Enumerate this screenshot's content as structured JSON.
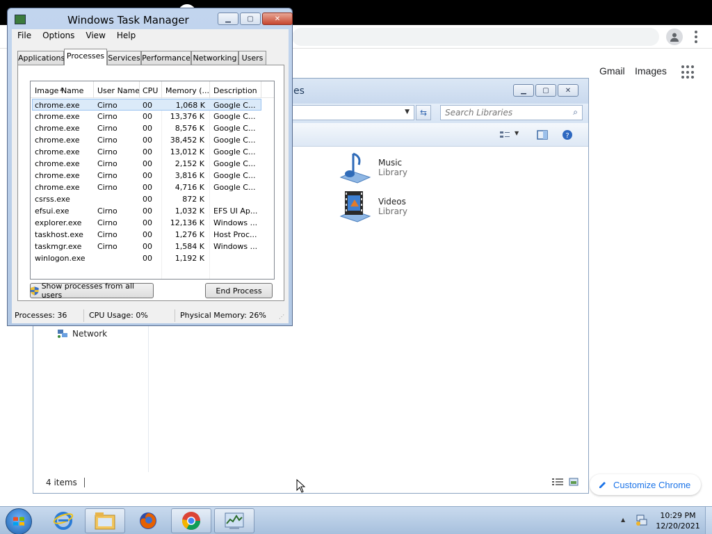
{
  "chrome": {
    "links": {
      "gmail": "Gmail",
      "images": "Images"
    },
    "customize_label": "Customize Chrome",
    "icons": {
      "profile": "profile-icon",
      "menu": "kebab-menu-icon",
      "apps": "apps-grid-icon",
      "pencil": "pencil-icon"
    },
    "accent": "#1a73e8"
  },
  "explorer": {
    "title_fragment": "es",
    "search": {
      "placeholder": "Search Libraries"
    },
    "libraries": [
      {
        "name": "Music",
        "type": "Library",
        "icon": "music-library-icon"
      },
      {
        "name": "Videos",
        "type": "Library",
        "icon": "videos-library-icon"
      }
    ],
    "nav": {
      "network": "Network"
    },
    "status": {
      "items": "4 items"
    }
  },
  "taskmanager": {
    "title": "Windows Task Manager",
    "menu": [
      "File",
      "Options",
      "View",
      "Help"
    ],
    "tabs": [
      "Applications",
      "Processes",
      "Services",
      "Performance",
      "Networking",
      "Users"
    ],
    "active_tab": "Processes",
    "columns": [
      "Image Name",
      "User Name",
      "CPU",
      "Memory (...",
      "Description"
    ],
    "rows": [
      {
        "name": "chrome.exe",
        "user": "Cirno",
        "cpu": "00",
        "mem": "1,068 K",
        "desc": "Google C..."
      },
      {
        "name": "chrome.exe",
        "user": "Cirno",
        "cpu": "00",
        "mem": "13,376 K",
        "desc": "Google C..."
      },
      {
        "name": "chrome.exe",
        "user": "Cirno",
        "cpu": "00",
        "mem": "8,576 K",
        "desc": "Google C..."
      },
      {
        "name": "chrome.exe",
        "user": "Cirno",
        "cpu": "00",
        "mem": "38,452 K",
        "desc": "Google C..."
      },
      {
        "name": "chrome.exe",
        "user": "Cirno",
        "cpu": "00",
        "mem": "13,012 K",
        "desc": "Google C..."
      },
      {
        "name": "chrome.exe",
        "user": "Cirno",
        "cpu": "00",
        "mem": "2,152 K",
        "desc": "Google C..."
      },
      {
        "name": "chrome.exe",
        "user": "Cirno",
        "cpu": "00",
        "mem": "3,816 K",
        "desc": "Google C..."
      },
      {
        "name": "chrome.exe",
        "user": "Cirno",
        "cpu": "00",
        "mem": "4,716 K",
        "desc": "Google C..."
      },
      {
        "name": "csrss.exe",
        "user": "",
        "cpu": "00",
        "mem": "872 K",
        "desc": ""
      },
      {
        "name": "efsui.exe",
        "user": "Cirno",
        "cpu": "00",
        "mem": "1,032 K",
        "desc": "EFS UI Ap..."
      },
      {
        "name": "explorer.exe",
        "user": "Cirno",
        "cpu": "00",
        "mem": "12,136 K",
        "desc": "Windows ..."
      },
      {
        "name": "taskhost.exe",
        "user": "Cirno",
        "cpu": "00",
        "mem": "1,276 K",
        "desc": "Host Proc..."
      },
      {
        "name": "taskmgr.exe",
        "user": "Cirno",
        "cpu": "00",
        "mem": "1,584 K",
        "desc": "Windows ..."
      },
      {
        "name": "winlogon.exe",
        "user": "",
        "cpu": "00",
        "mem": "1,192 K",
        "desc": ""
      }
    ],
    "buttons": {
      "show_all": "Show processes from all users",
      "end_process": "End Process"
    },
    "status": {
      "processes": "Processes: 36",
      "cpu": "CPU Usage: 0%",
      "memory": "Physical Memory: 26%"
    }
  },
  "taskbar": {
    "apps": [
      "start-orb-icon",
      "internet-explorer-icon",
      "file-explorer-icon",
      "firefox-icon",
      "chrome-icon",
      "task-manager-icon"
    ],
    "clock": {
      "time": "10:29 PM",
      "date": "12/20/2021"
    }
  }
}
